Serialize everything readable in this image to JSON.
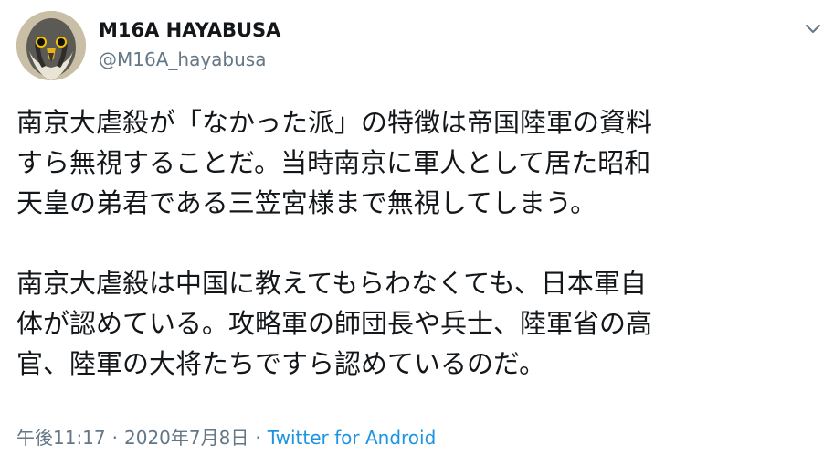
{
  "user": {
    "display_name": "M16A HAYABUSA",
    "handle": "@M16A_hayabusa",
    "avatar_icon": "falcon-avatar-icon"
  },
  "menu_icon": "chevron-down-icon",
  "tweet": {
    "paragraphs": [
      {
        "lines": [
          "南京大虐殺が「なかった派」の特徴は帝国陸軍の資料",
          "すら無視することだ。当時南京に軍人として居た昭和",
          "天皇の弟君である三笠宮様まで無視してしまう。"
        ]
      },
      {
        "lines": [
          "南京大虐殺は中国に教えてもらわなくても、日本軍自",
          "体が認めている。攻略軍の師団長や兵士、陸軍省の高",
          "官、陸軍の大将たちですら認めているのだ。"
        ]
      }
    ]
  },
  "meta": {
    "time": "午後11:17",
    "separator": "·",
    "date": "2020年7月8日",
    "source": "Twitter for Android"
  },
  "colors": {
    "text": "#14171a",
    "secondary": "#657786",
    "link": "#1b95e0"
  }
}
